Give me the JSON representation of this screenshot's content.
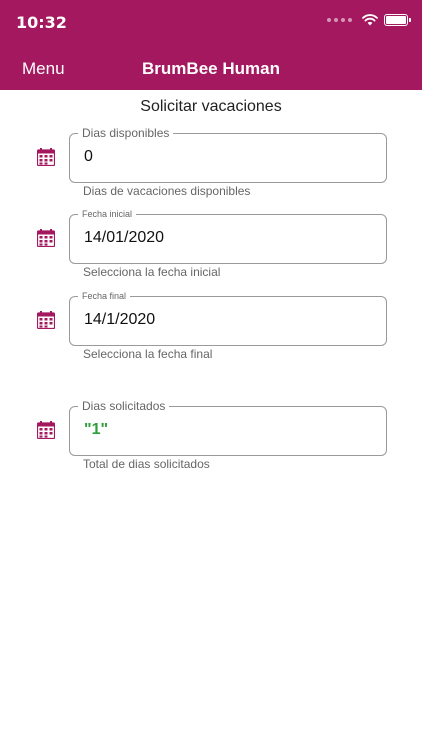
{
  "status_bar": {
    "time": "10:32"
  },
  "header": {
    "menu_label": "Menu",
    "title": "BrumBee Human"
  },
  "page": {
    "title": "Solicitar vacaciones"
  },
  "fields": [
    {
      "label": "Dias disponibles",
      "value": "0",
      "helper": "Dias de vacaciones disponibles",
      "icon": "calendar-icon"
    },
    {
      "label": "Fecha inicial",
      "value": "14/01/2020",
      "helper": "Selecciona la fecha inicial",
      "icon": "calendar-icon"
    },
    {
      "label": "Fecha final",
      "value": "14/1/2020",
      "helper": "Selecciona la fecha final",
      "icon": "calendar-icon"
    },
    {
      "label": "Dias solicitados",
      "value": "\"1\"",
      "helper": "Total de dias solicitados",
      "icon": "calendar-icon"
    }
  ],
  "colors": {
    "brand": "#a3185e",
    "icon": "#a3185e",
    "requested_value": "#2e9d3a"
  }
}
